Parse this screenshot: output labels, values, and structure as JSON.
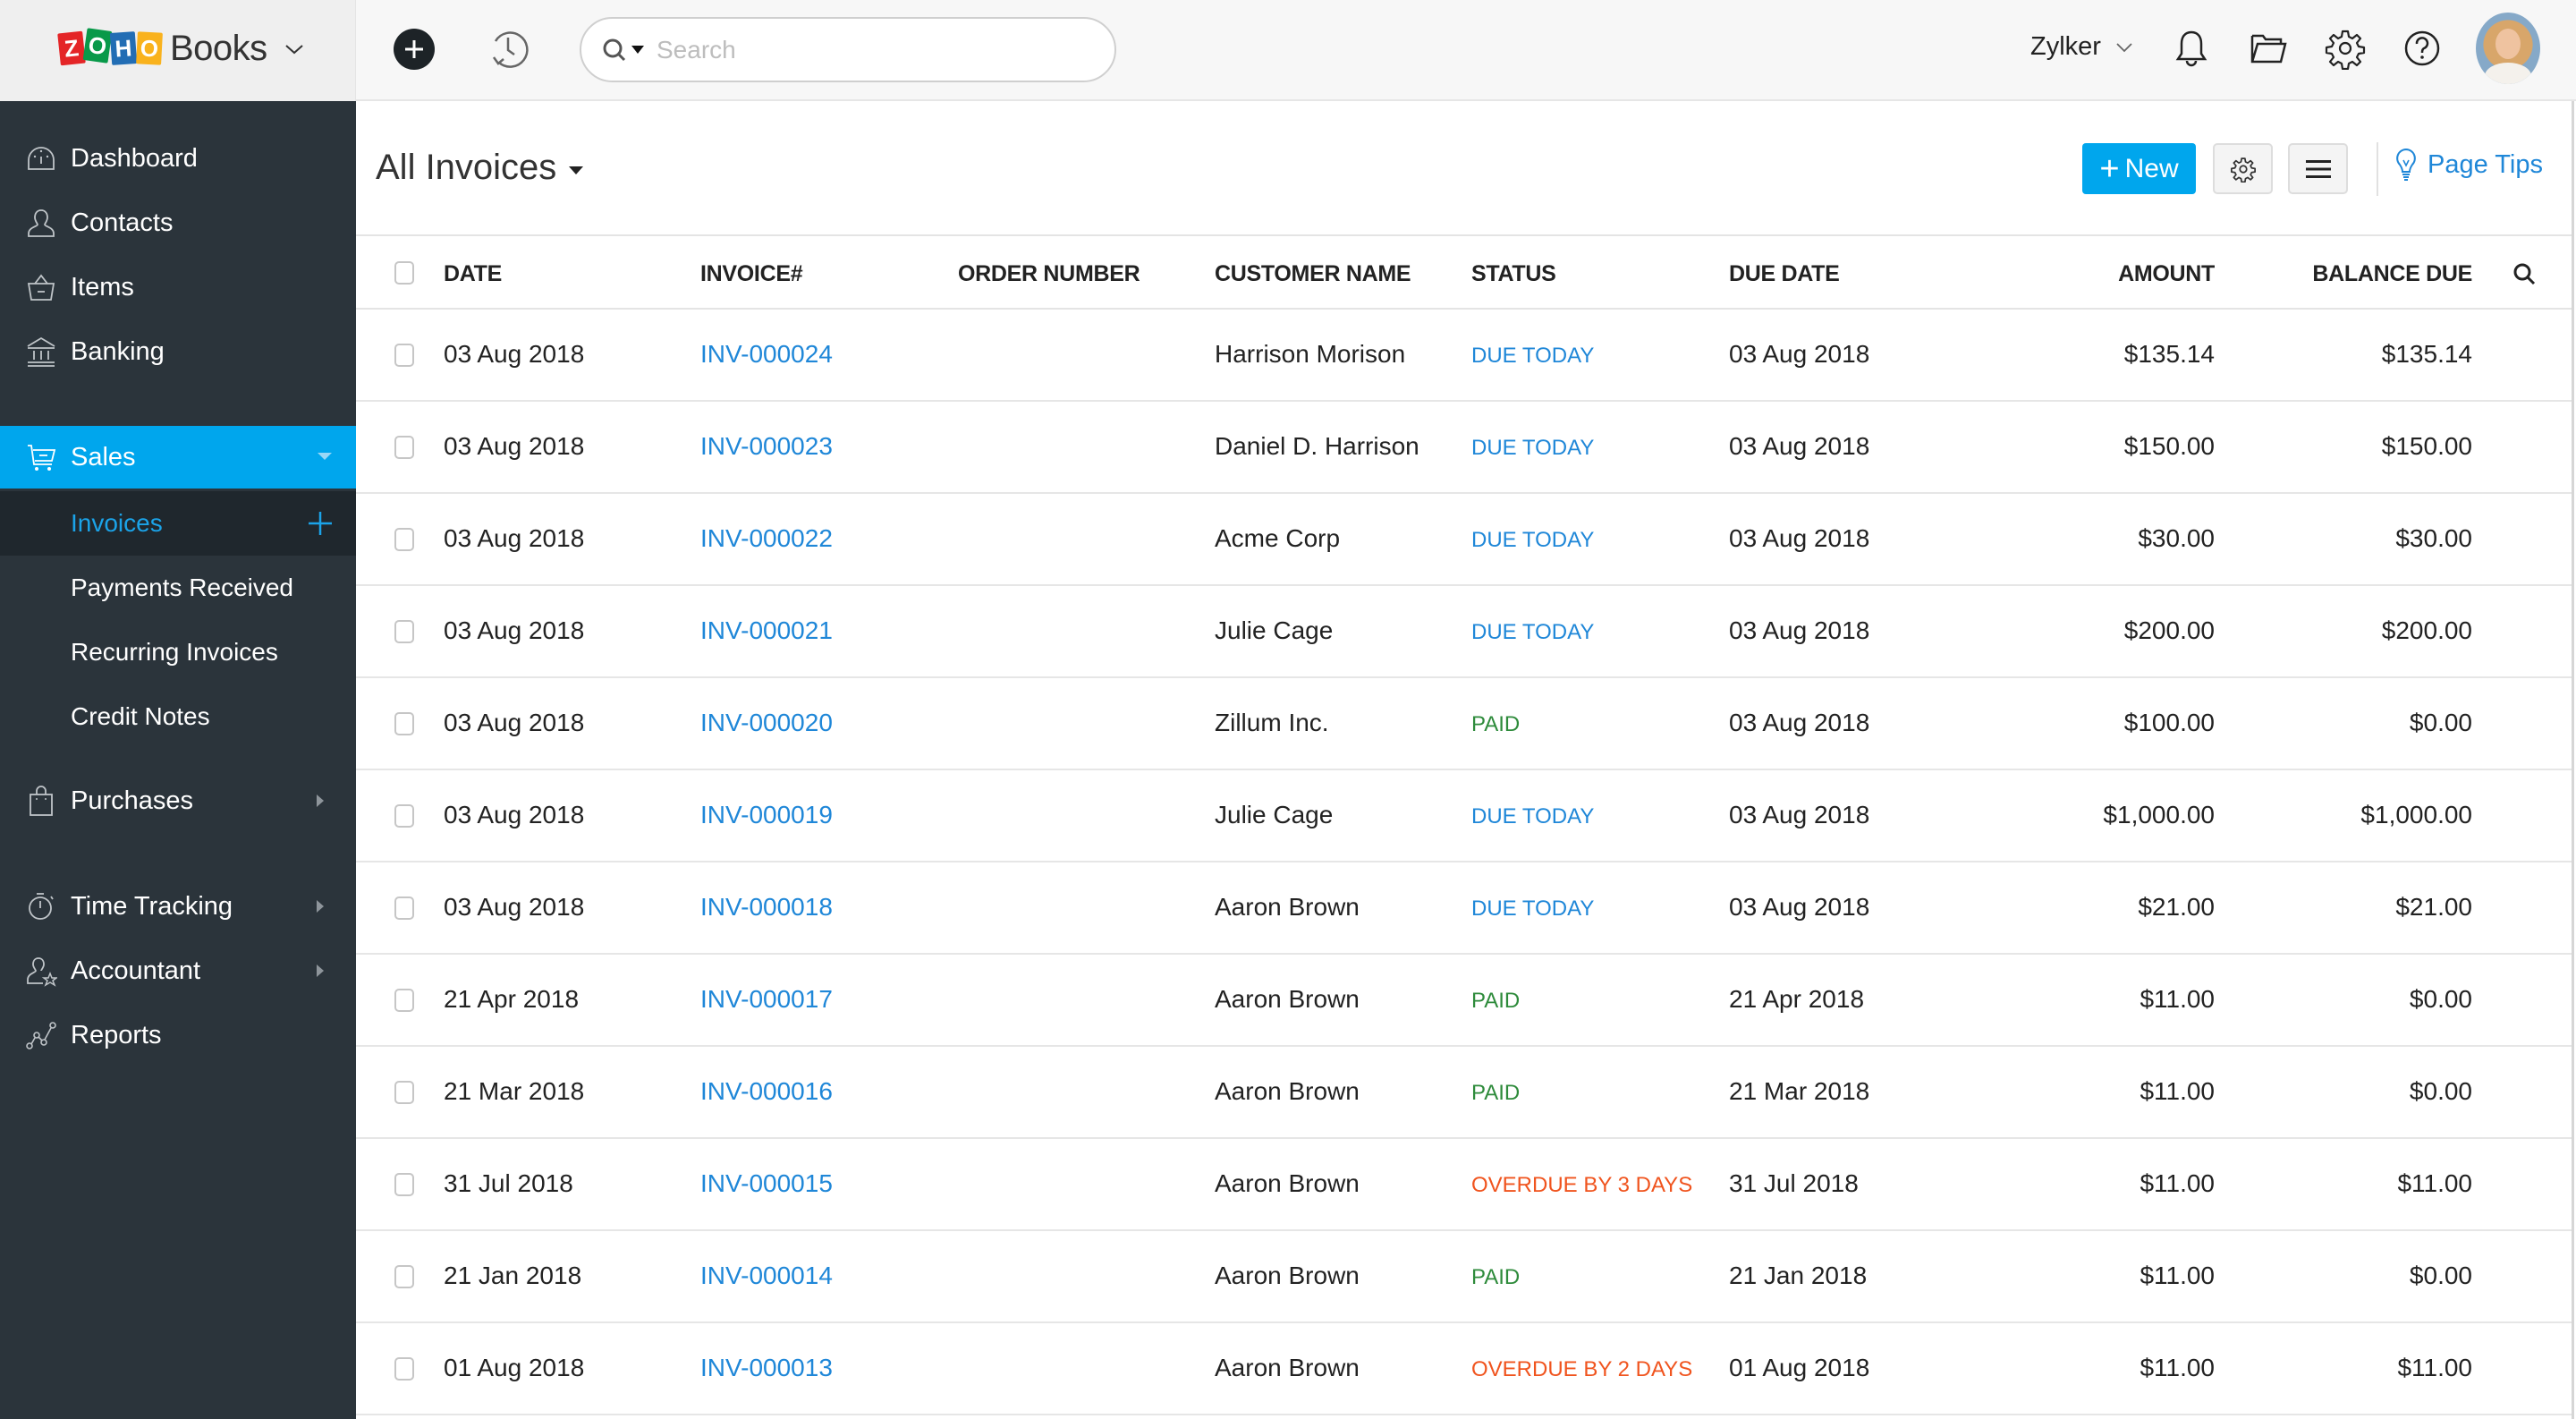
{
  "app": {
    "brand_logo_letters": [
      "Z",
      "O",
      "H",
      "O"
    ],
    "brand_word": "Books",
    "search_placeholder": "Search",
    "search_value": "",
    "org_name": "Zylker",
    "header_icons": [
      "add-icon",
      "recent-history-icon",
      "notifications-bell-icon",
      "documents-folder-icon",
      "settings-gear-icon",
      "help-icon",
      "user-avatar"
    ]
  },
  "sidebar": {
    "items": [
      {
        "label": "Dashboard",
        "icon": "dashboard-gauge-icon"
      },
      {
        "label": "Contacts",
        "icon": "contacts-person-icon"
      },
      {
        "label": "Items",
        "icon": "items-basket-icon"
      },
      {
        "label": "Banking",
        "icon": "banking-bank-icon"
      },
      {
        "label": "Sales",
        "icon": "sales-cart-icon",
        "active": true,
        "expanded": true
      },
      {
        "label": "Purchases",
        "icon": "purchases-bag-icon",
        "has_submenu": true
      },
      {
        "label": "Time Tracking",
        "icon": "time-tracking-stopwatch-icon",
        "has_submenu": true
      },
      {
        "label": "Accountant",
        "icon": "accountant-person-star-icon",
        "has_submenu": true
      },
      {
        "label": "Reports",
        "icon": "reports-chart-icon"
      }
    ],
    "sales_sub_items": [
      {
        "label": "Invoices",
        "current": true
      },
      {
        "label": "Payments Received"
      },
      {
        "label": "Recurring Invoices"
      },
      {
        "label": "Credit Notes"
      }
    ]
  },
  "content": {
    "view_title": "All Invoices",
    "new_button": "New",
    "page_tips": "Page Tips",
    "columns": [
      "DATE",
      "INVOICE#",
      "ORDER NUMBER",
      "CUSTOMER NAME",
      "STATUS",
      "DUE DATE",
      "AMOUNT",
      "BALANCE DUE"
    ],
    "status_colors": {
      "DUE TODAY": "#1f87d8",
      "PAID": "#2e8b3b",
      "OVERDUE": "#f0541e"
    },
    "rows": [
      {
        "date": "03 Aug 2018",
        "invoice": "INV-000024",
        "order": "",
        "customer": "Harrison Morison",
        "status": "DUE TODAY",
        "status_type": "due",
        "due_date": "03 Aug 2018",
        "amount": "$135.14",
        "balance": "$135.14"
      },
      {
        "date": "03 Aug 2018",
        "invoice": "INV-000023",
        "order": "",
        "customer": "Daniel D. Harrison",
        "status": "DUE TODAY",
        "status_type": "due",
        "due_date": "03 Aug 2018",
        "amount": "$150.00",
        "balance": "$150.00"
      },
      {
        "date": "03 Aug 2018",
        "invoice": "INV-000022",
        "order": "",
        "customer": "Acme Corp",
        "status": "DUE TODAY",
        "status_type": "due",
        "due_date": "03 Aug 2018",
        "amount": "$30.00",
        "balance": "$30.00"
      },
      {
        "date": "03 Aug 2018",
        "invoice": "INV-000021",
        "order": "",
        "customer": "Julie Cage",
        "status": "DUE TODAY",
        "status_type": "due",
        "due_date": "03 Aug 2018",
        "amount": "$200.00",
        "balance": "$200.00"
      },
      {
        "date": "03 Aug 2018",
        "invoice": "INV-000020",
        "order": "",
        "customer": "Zillum Inc.",
        "status": "PAID",
        "status_type": "paid",
        "due_date": "03 Aug 2018",
        "amount": "$100.00",
        "balance": "$0.00"
      },
      {
        "date": "03 Aug 2018",
        "invoice": "INV-000019",
        "order": "",
        "customer": "Julie Cage",
        "status": "DUE TODAY",
        "status_type": "due",
        "due_date": "03 Aug 2018",
        "amount": "$1,000.00",
        "balance": "$1,000.00"
      },
      {
        "date": "03 Aug 2018",
        "invoice": "INV-000018",
        "order": "",
        "customer": "Aaron Brown",
        "status": "DUE TODAY",
        "status_type": "due",
        "due_date": "03 Aug 2018",
        "amount": "$21.00",
        "balance": "$21.00"
      },
      {
        "date": "21 Apr 2018",
        "invoice": "INV-000017",
        "order": "",
        "customer": "Aaron Brown",
        "status": "PAID",
        "status_type": "paid",
        "due_date": "21 Apr 2018",
        "amount": "$11.00",
        "balance": "$0.00"
      },
      {
        "date": "21 Mar 2018",
        "invoice": "INV-000016",
        "order": "",
        "customer": "Aaron Brown",
        "status": "PAID",
        "status_type": "paid",
        "due_date": "21 Mar 2018",
        "amount": "$11.00",
        "balance": "$0.00"
      },
      {
        "date": "31 Jul 2018",
        "invoice": "INV-000015",
        "order": "",
        "customer": "Aaron Brown",
        "status": "OVERDUE BY 3 DAYS",
        "status_type": "overdue",
        "due_date": "31 Jul 2018",
        "amount": "$11.00",
        "balance": "$11.00"
      },
      {
        "date": "21 Jan 2018",
        "invoice": "INV-000014",
        "order": "",
        "customer": "Aaron Brown",
        "status": "PAID",
        "status_type": "paid",
        "due_date": "21 Jan 2018",
        "amount": "$11.00",
        "balance": "$0.00"
      },
      {
        "date": "01 Aug 2018",
        "invoice": "INV-000013",
        "order": "",
        "customer": "Aaron Brown",
        "status": "OVERDUE BY 2 DAYS",
        "status_type": "overdue",
        "due_date": "01 Aug 2018",
        "amount": "$11.00",
        "balance": "$11.00"
      }
    ]
  },
  "colors": {
    "accent": "#00a6ed",
    "link": "#1f87d8",
    "sidebar_bg": "#2b343b",
    "sidebar_current_bg": "#1f272d"
  }
}
